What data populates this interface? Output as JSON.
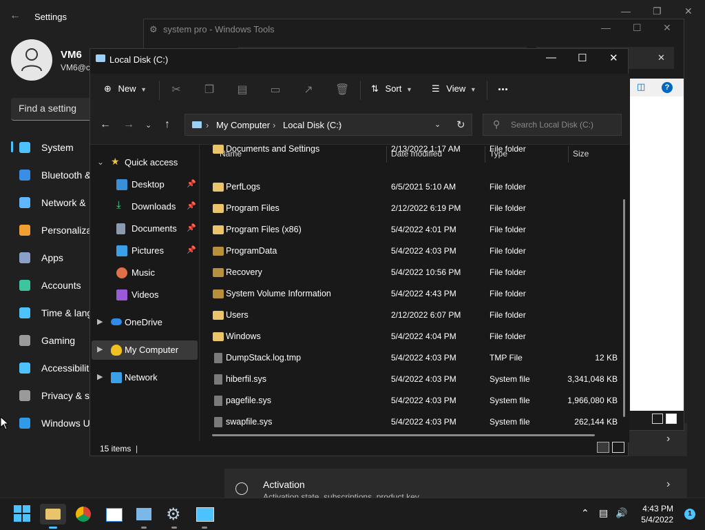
{
  "settings": {
    "title": "Settings",
    "user_name": "VM6",
    "user_email": "VM6@c",
    "search_placeholder": "Find a setting",
    "nav": [
      {
        "label": "System",
        "color": "#4cc2ff"
      },
      {
        "label": "Bluetooth &",
        "color": "#3b8ee6"
      },
      {
        "label": "Network &",
        "color": "#5fb7ff"
      },
      {
        "label": "Personaliza",
        "color": "#f0a030"
      },
      {
        "label": "Apps",
        "color": "#8aa0c8"
      },
      {
        "label": "Accounts",
        "color": "#3cc5a0"
      },
      {
        "label": "Time & lang",
        "color": "#4cc2ff"
      },
      {
        "label": "Gaming",
        "color": "#9a9a9a"
      },
      {
        "label": "Accessibilit",
        "color": "#4cc2ff"
      },
      {
        "label": "Privacy & s",
        "color": "#9a9a9a"
      },
      {
        "label": "Windows U",
        "color": "#2f9be8"
      }
    ],
    "activation_title": "Activation",
    "activation_sub": "Activation state, subscriptions, product key"
  },
  "wintools": {
    "title": "system pro - Windows Tools"
  },
  "explorer": {
    "title": "Local Disk (C:)",
    "toolbar": {
      "new_label": "New",
      "sort_label": "Sort",
      "view_label": "View",
      "more_label": "..."
    },
    "address": {
      "crumb1": "My Computer",
      "crumb2": "Local Disk (C:)"
    },
    "search_placeholder": "Search Local Disk (C:)",
    "nav": {
      "quick_access": "Quick access",
      "desktop": "Desktop",
      "downloads": "Downloads",
      "documents": "Documents",
      "pictures": "Pictures",
      "music": "Music",
      "videos": "Videos",
      "onedrive": "OneDrive",
      "my_computer": "My Computer",
      "network": "Network"
    },
    "columns": {
      "name": "Name",
      "date": "Date modified",
      "type": "Type",
      "size": "Size"
    },
    "rows": [
      {
        "name": "Documents and Settings",
        "date": "2/13/2022 1:17 AM",
        "type": "File folder",
        "size": ""
      },
      {
        "name": "PerfLogs",
        "date": "6/5/2021 5:10 AM",
        "type": "File folder",
        "size": ""
      },
      {
        "name": "Program Files",
        "date": "2/12/2022 6:19 PM",
        "type": "File folder",
        "size": ""
      },
      {
        "name": "Program Files (x86)",
        "date": "5/4/2022 4:01 PM",
        "type": "File folder",
        "size": ""
      },
      {
        "name": "ProgramData",
        "date": "5/4/2022 4:03 PM",
        "type": "File folder",
        "size": ""
      },
      {
        "name": "Recovery",
        "date": "5/4/2022 10:56 PM",
        "type": "File folder",
        "size": ""
      },
      {
        "name": "System Volume Information",
        "date": "5/4/2022 4:43 PM",
        "type": "File folder",
        "size": ""
      },
      {
        "name": "Users",
        "date": "2/12/2022 6:07 PM",
        "type": "File folder",
        "size": ""
      },
      {
        "name": "Windows",
        "date": "5/4/2022 4:04 PM",
        "type": "File folder",
        "size": ""
      },
      {
        "name": "DumpStack.log.tmp",
        "date": "5/4/2022 4:03 PM",
        "type": "TMP File",
        "size": "12 KB"
      },
      {
        "name": "hiberfil.sys",
        "date": "5/4/2022 4:03 PM",
        "type": "System file",
        "size": "3,341,048 KB"
      },
      {
        "name": "pagefile.sys",
        "date": "5/4/2022 4:03 PM",
        "type": "System file",
        "size": "1,966,080 KB"
      },
      {
        "name": "swapfile.sys",
        "date": "5/4/2022 4:03 PM",
        "type": "System file",
        "size": "262,144 KB"
      }
    ],
    "status": "15 items"
  },
  "taskbar": {
    "time": "4:43 PM",
    "date": "5/4/2022",
    "notifications": "1"
  }
}
